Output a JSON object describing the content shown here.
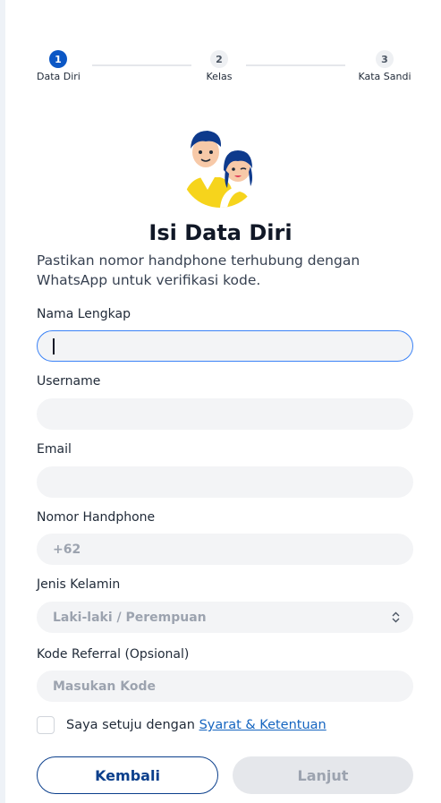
{
  "stepper": {
    "steps": [
      {
        "number": "1",
        "label": "Data Diri",
        "state": "active"
      },
      {
        "number": "2",
        "label": "Kelas",
        "state": "inactive"
      },
      {
        "number": "3",
        "label": "Kata Sandi",
        "state": "inactive"
      }
    ]
  },
  "header": {
    "title": "Isi Data Diri",
    "subtitle": "Pastikan nomor handphone terhubung dengan WhatsApp untuk verifikasi kode."
  },
  "form": {
    "full_name": {
      "label": "Nama Lengkap",
      "value": "",
      "placeholder": ""
    },
    "username": {
      "label": "Username",
      "value": "",
      "placeholder": ""
    },
    "email": {
      "label": "Email",
      "value": "",
      "placeholder": ""
    },
    "phone": {
      "label": "Nomor Handphone",
      "placeholder": "+62"
    },
    "gender": {
      "label": "Jenis Kelamin",
      "selected": "Laki-laki / Perempuan"
    },
    "referral": {
      "label": "Kode Referral (Opsional)",
      "placeholder": "Masukan Kode"
    }
  },
  "agreement": {
    "text": "Saya setuju dengan",
    "link": "Syarat & Ketentuan",
    "checked": false
  },
  "actions": {
    "back_label": "Kembali",
    "next_label": "Lanjut"
  },
  "colors": {
    "primary": "#0b57c5",
    "focus_border": "#3b82f6",
    "link": "#1565c0",
    "button_outline": "#0b3f8c",
    "disabled_bg": "#e5e7eb",
    "illustration_accent": "#f6d41c"
  }
}
